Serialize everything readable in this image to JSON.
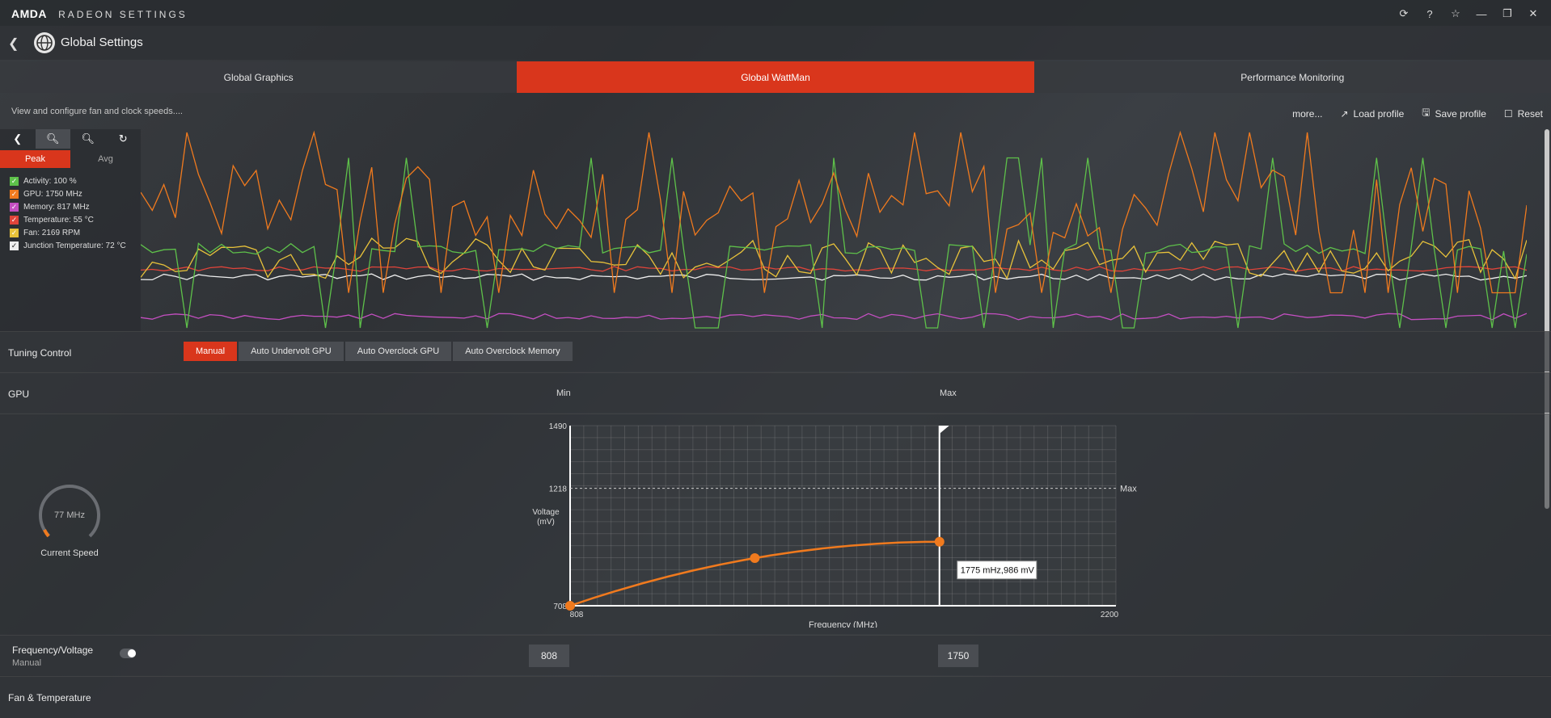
{
  "app": {
    "brand": "AMDA",
    "name": "RADEON SETTINGS"
  },
  "window_buttons": [
    {
      "name": "refresh-icon",
      "glyph": "⟳"
    },
    {
      "name": "help-icon",
      "glyph": "?"
    },
    {
      "name": "star-icon",
      "glyph": "☆"
    },
    {
      "name": "minimize-icon",
      "glyph": "—"
    },
    {
      "name": "restore-icon",
      "glyph": "❐"
    },
    {
      "name": "close-icon",
      "glyph": "✕"
    }
  ],
  "header": {
    "title": "Global Settings"
  },
  "tabs": [
    {
      "label": "Global Graphics",
      "active": false
    },
    {
      "label": "Global WattMan",
      "active": true
    },
    {
      "label": "Performance Monitoring",
      "active": false
    }
  ],
  "info": {
    "description": "View and configure fan and clock speeds...."
  },
  "actions": {
    "more": "more...",
    "load": "Load profile",
    "save": "Save profile",
    "reset": "Reset"
  },
  "graph_panel": {
    "peak": "Peak",
    "avg": "Avg",
    "legend": [
      {
        "label": "Activity: 100 %",
        "color": "#5ec14a"
      },
      {
        "label": "GPU: 1750 MHz",
        "color": "#f07a1e"
      },
      {
        "label": "Memory: 817 MHz",
        "color": "#c44fc1"
      },
      {
        "label": "Temperature: 55 °C",
        "color": "#e0443a"
      },
      {
        "label": "Fan: 2169 RPM",
        "color": "#e8c23a"
      },
      {
        "label": "Junction Temperature: 72 °C",
        "color": "#eeeeee"
      }
    ]
  },
  "tuning": {
    "label": "Tuning Control",
    "buttons": [
      {
        "label": "Manual",
        "active": true
      },
      {
        "label": "Auto Undervolt GPU",
        "active": false
      },
      {
        "label": "Auto Overclock GPU",
        "active": false
      },
      {
        "label": "Auto Overclock Memory",
        "active": false
      }
    ]
  },
  "gpu": {
    "label": "GPU",
    "min_label": "Min",
    "max_label": "Max",
    "current_speed": "77 MHz",
    "current_speed_label": "Current Speed"
  },
  "chart_data": {
    "type": "line",
    "xlabel": "Frequency (MHz)",
    "ylabel": "Voltage (mV)",
    "xlim": [
      808,
      2200
    ],
    "ylim": [
      708,
      1490
    ],
    "ytick_labels": [
      "1490",
      "1218",
      "708"
    ],
    "xtick_labels": [
      "808",
      "2200"
    ],
    "max_line_label": "Max",
    "max_voltage": 1218,
    "points": [
      {
        "x": 808,
        "y": 708
      },
      {
        "x": 1279,
        "y": 915
      },
      {
        "x": 1750,
        "y": 986
      }
    ],
    "tooltip": "1775 mHz,986 mV"
  },
  "freq_voltage": {
    "label": "Frequency/Voltage",
    "mode": "Manual",
    "min_value": "808",
    "max_value": "1750"
  },
  "fan_temp": {
    "label": "Fan & Temperature"
  }
}
